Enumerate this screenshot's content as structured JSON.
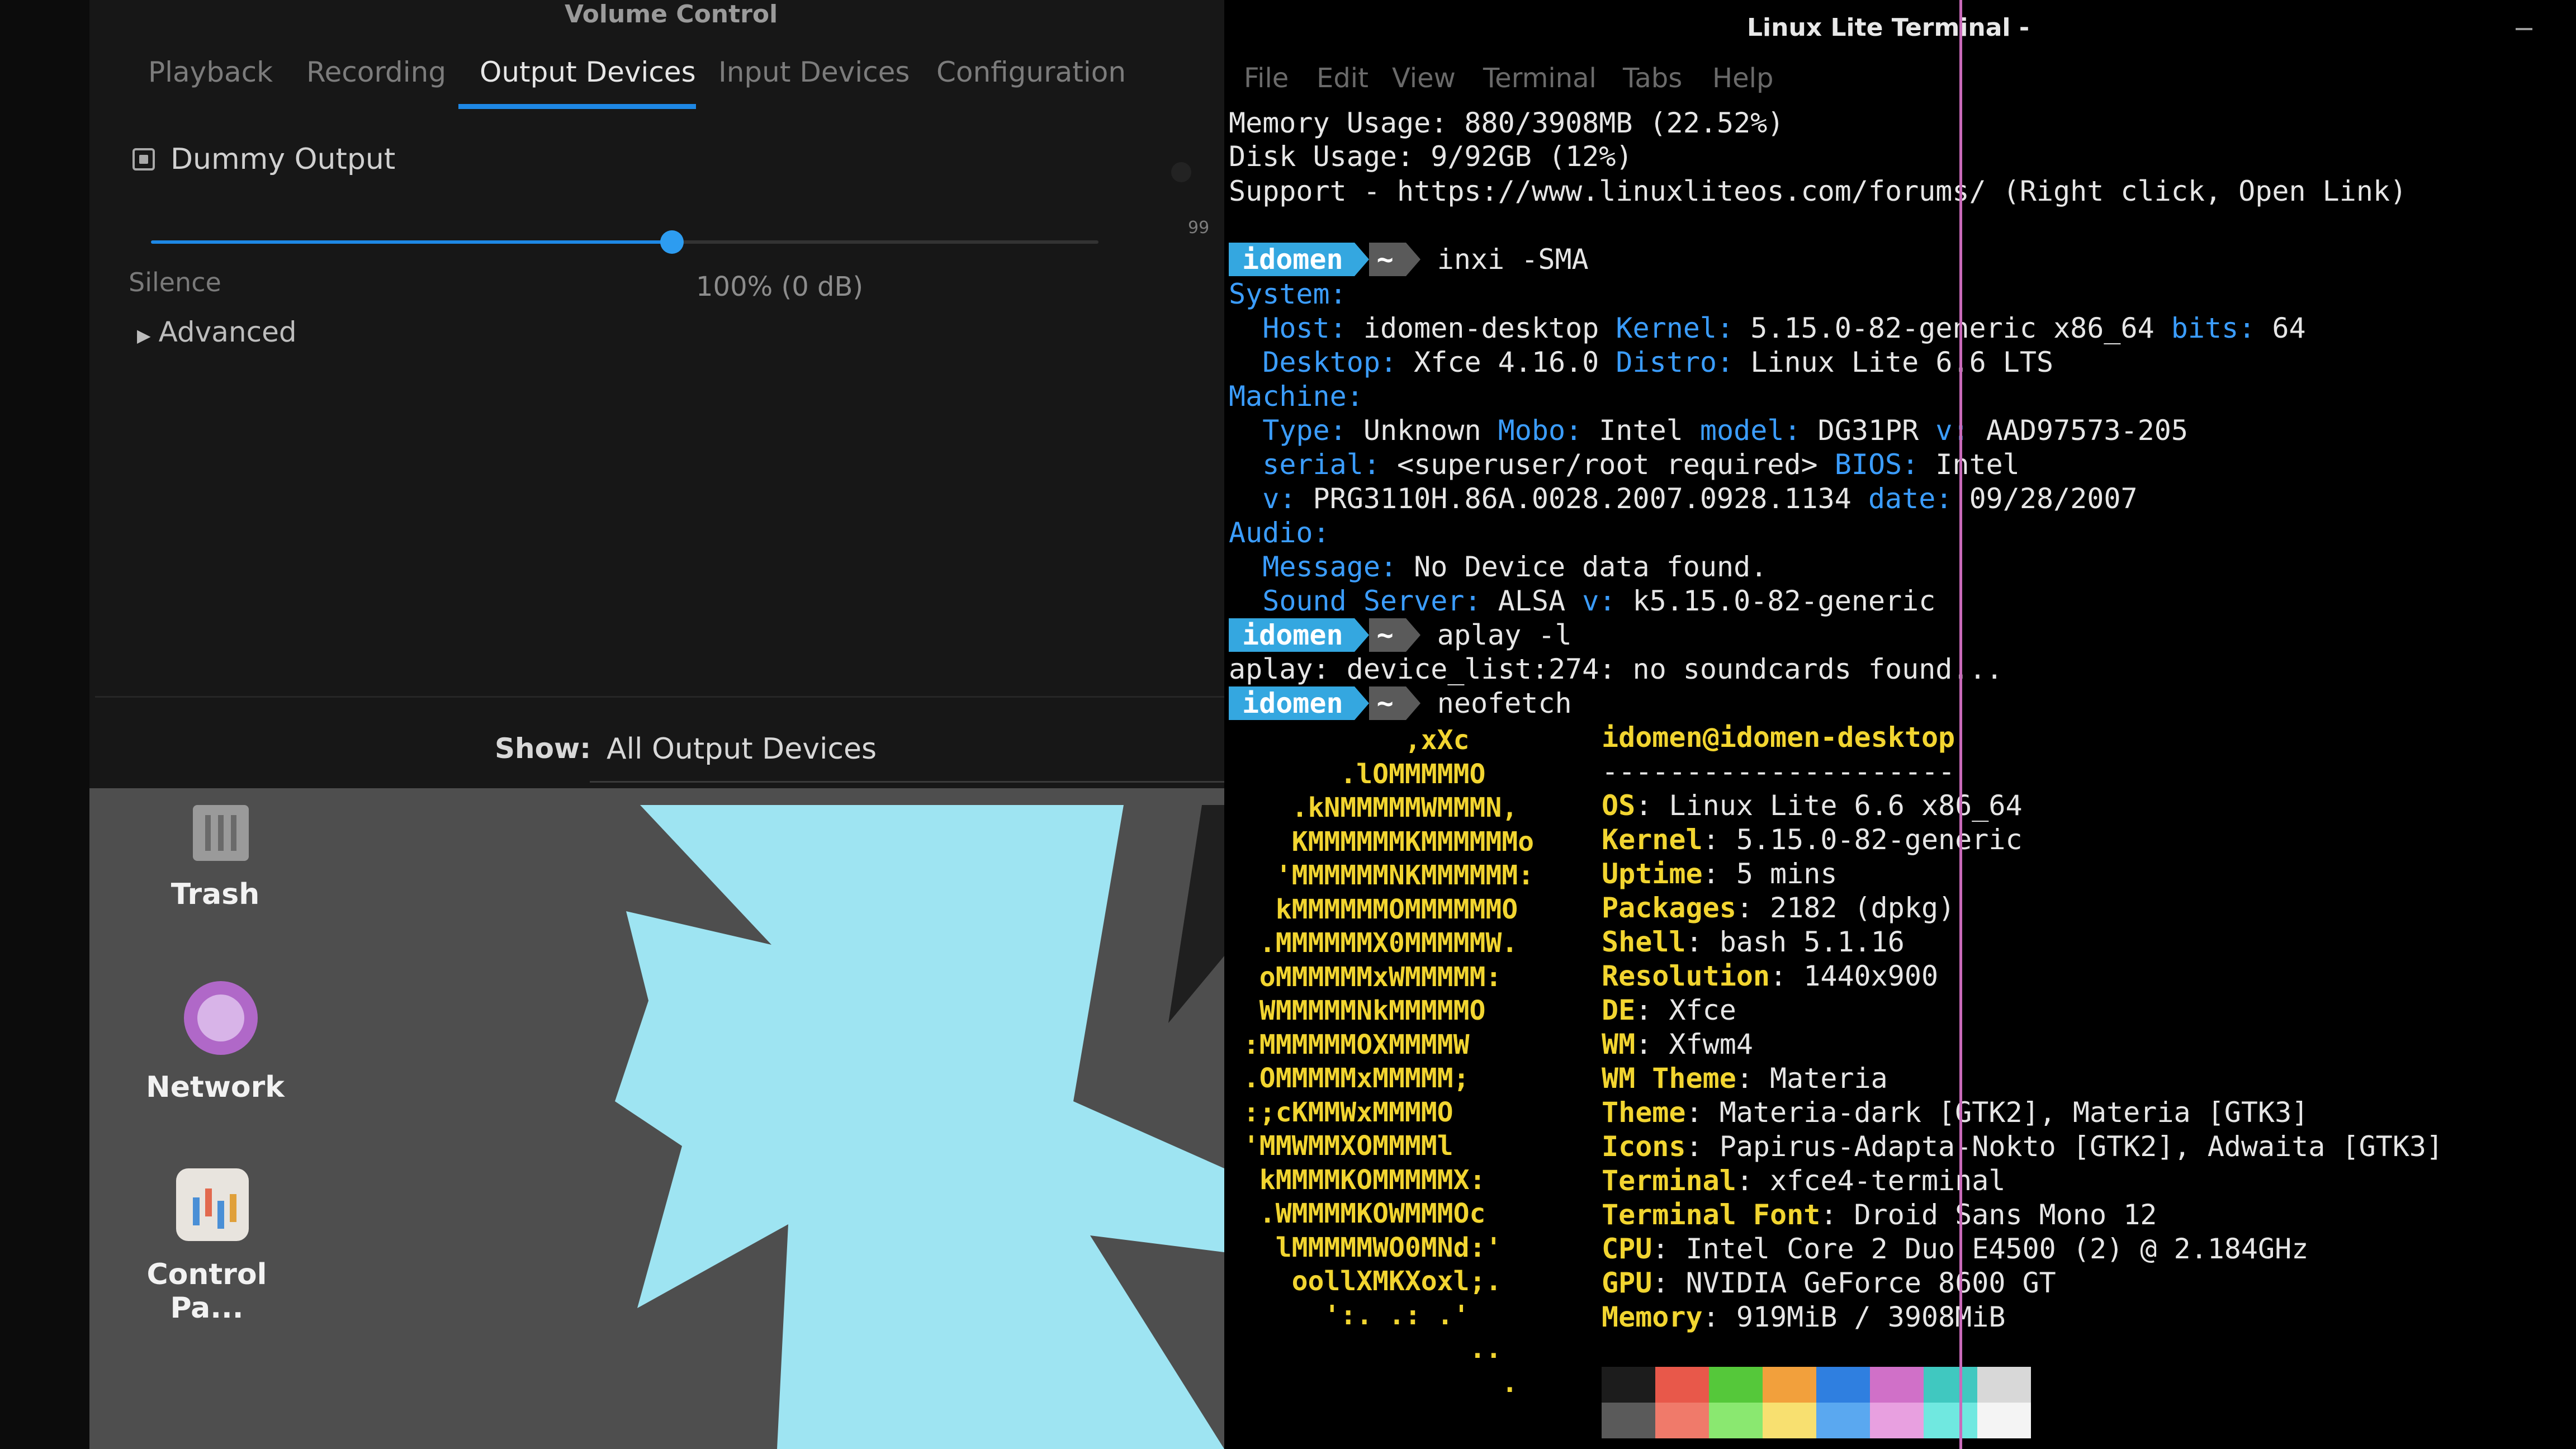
{
  "volume_control": {
    "title": "Volume Control",
    "tabs": [
      "Playback",
      "Recording",
      "Output Devices",
      "Input Devices",
      "Configuration"
    ],
    "active_tab": "Output Devices",
    "device_name": "Dummy Output",
    "volume_fraction": 0.55,
    "peak_label": "99",
    "silence_label": "Silence",
    "volume_readout": "100% (0 dB)",
    "advanced_label": "Advanced",
    "show_label": "Show:",
    "show_value": "All Output Devices"
  },
  "desktop": {
    "icons": [
      {
        "label": "Trash",
        "icon": "trash-icon"
      },
      {
        "label": "Network",
        "icon": "network-icon"
      },
      {
        "label": "Control Pa...",
        "icon": "control-panel-icon"
      }
    ]
  },
  "terminal": {
    "title": "Linux Lite Terminal -",
    "menu": [
      "File",
      "Edit",
      "View",
      "Terminal",
      "Tabs",
      "Help"
    ],
    "prompt_user": "idomen",
    "prompt_dir": "~",
    "line_memory": "Memory Usage: 880/3908MB (22.52%)",
    "line_disk": "Disk Usage: 9/92GB (12%)",
    "line_support": "Support - https://www.linuxliteos.com/forums/ (Right click, Open Link)",
    "cmd1": "inxi -SMA",
    "inxi": {
      "system": "System:",
      "host_k": "Host:",
      "host_v": "idomen-desktop",
      "kernel_k": "Kernel:",
      "kernel_v": "5.15.0-82-generic x86_64",
      "bits_k": "bits:",
      "bits_v": "64",
      "desktop_k": "Desktop:",
      "desktop_v": "Xfce 4.16.0",
      "distro_k": "Distro:",
      "distro_v": "Linux Lite 6.6 LTS",
      "machine": "Machine:",
      "type_k": "Type:",
      "type_v": "Unknown",
      "mobo_k": "Mobo:",
      "mobo_v": "Intel",
      "model_k": "model:",
      "model_v": "DG31PR",
      "v_k": "v:",
      "v_v": "AAD97573-205",
      "serial_k": "serial:",
      "serial_v": "<superuser/root required>",
      "bios_k": "BIOS:",
      "bios_v": "Intel",
      "biosv_k": "v:",
      "biosv_v": "PRG3110H.86A.0028.2007.0928.1134",
      "date_k": "date:",
      "date_v": "09/28/2007",
      "audio": "Audio:",
      "message_k": "Message:",
      "message_v": "No Device data found.",
      "sound_k": "Sound Server:",
      "sound_v": "ALSA",
      "soundv_k": "v:",
      "soundv_v": "k5.15.0-82-generic"
    },
    "cmd2": "aplay -l",
    "aplay_output": "aplay: device_list:274: no soundcards found...",
    "cmd3": "neofetch",
    "neofetch": {
      "header": "idomen@idomen-desktop",
      "rule": "---------------------",
      "fields": [
        {
          "k": "OS",
          "v": ": Linux Lite 6.6 x86_64"
        },
        {
          "k": "Kernel",
          "v": ": 5.15.0-82-generic"
        },
        {
          "k": "Uptime",
          "v": ": 5 mins"
        },
        {
          "k": "Packages",
          "v": ": 2182 (dpkg)"
        },
        {
          "k": "Shell",
          "v": ": bash 5.1.16"
        },
        {
          "k": "Resolution",
          "v": ": 1440x900"
        },
        {
          "k": "DE",
          "v": ": Xfce"
        },
        {
          "k": "WM",
          "v": ": Xfwm4"
        },
        {
          "k": "WM Theme",
          "v": ": Materia"
        },
        {
          "k": "Theme",
          "v": ": Materia-dark [GTK2], Materia [GTK3]"
        },
        {
          "k": "Icons",
          "v": ": Papirus-Adapta-Nokto [GTK2], Adwaita [GTK3]"
        },
        {
          "k": "Terminal",
          "v": ": xfce4-terminal"
        },
        {
          "k": "Terminal Font",
          "v": ": Droid Sans Mono 12"
        },
        {
          "k": "CPU",
          "v": ": Intel Core 2 Duo E4500 (2) @ 2.184GHz"
        },
        {
          "k": "GPU",
          "v": ": NVIDIA GeForce 8600 GT"
        },
        {
          "k": "Memory",
          "v": ": 919MiB / 3908MiB"
        }
      ],
      "ascii_art": [
        "           ,xXc",
        "       .lOMMMMMO",
        "    .kNMMMMMWMMMN,",
        "    KMMMMMMKMMMMMMo",
        "   'MMMMMMNKMMMMMM:",
        "   kMMMMMMOMMMMMMO",
        "  .MMMMMMX0MMMMMW.",
        "  oMMMMMMxWMMMMM:",
        "  WMMMMMNkMMMMMO",
        " :MMMMMMOXMMMMW",
        " .OMMMMMxMMMMM;",
        " :;cKMMWxMMMMO",
        " 'MMWMMXOMMMMl",
        "  kMMMMKOMMMMMX:",
        "  .WMMMMKOWMMMOc",
        "   lMMMMMWO0MNd:'",
        "    oollXMKXoxl;.",
        "      ':. .: .'",
        "               ..",
        "                 ."
      ],
      "palette_top": [
        "#1c1c1c",
        "#e8584a",
        "#55c83a",
        "#f2a03c",
        "#2f7fe0",
        "#d070c8",
        "#40c8c0",
        "#d8d8d8"
      ],
      "palette_bottom": [
        "#5a5a5a",
        "#f07a6a",
        "#8ae870",
        "#f8e070",
        "#5aa8f0",
        "#e8a0e0",
        "#70e8e0",
        "#f4f4f4"
      ]
    }
  }
}
